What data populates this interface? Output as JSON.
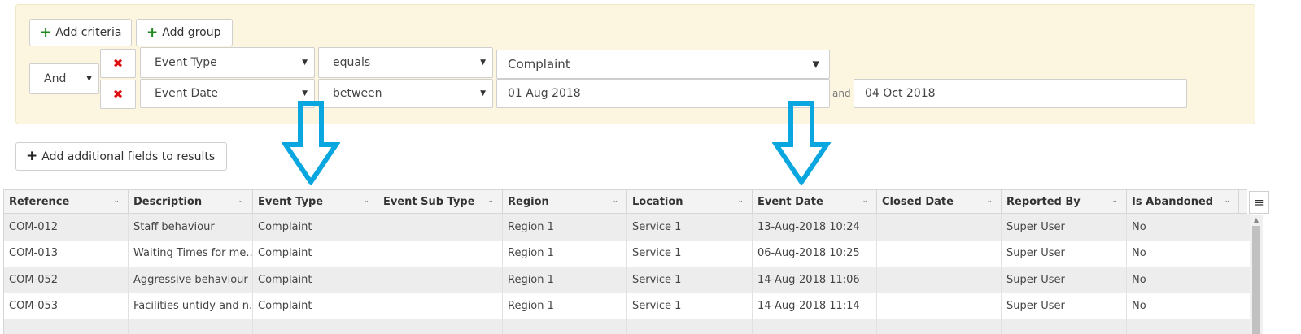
{
  "criteria": {
    "add_criteria_label": "Add criteria",
    "add_group_label": "Add group",
    "logic_operator": "And",
    "rows": [
      {
        "field": "Event Type",
        "operator": "equals",
        "value": "Complaint"
      },
      {
        "field": "Event Date",
        "operator": "between",
        "value_from": "01 Aug 2018",
        "joiner": "and",
        "value_to": "04 Oct 2018"
      }
    ]
  },
  "add_fields_label": "Add additional fields to results",
  "colors": {
    "accent_arrow": "#0aa6df",
    "panel_bg": "#fcf6e1",
    "remove_red": "#e01010",
    "add_green": "#1e8a1e"
  },
  "grid": {
    "columns": [
      "Reference",
      "Description",
      "Event Type",
      "Event Sub Type",
      "Region",
      "Location",
      "Event Date",
      "Closed Date",
      "Reported By",
      "Is Abandoned"
    ],
    "rows": [
      [
        "COM-012",
        "Staff behaviour",
        "Complaint",
        "",
        "Region 1",
        "Service 1",
        "13-Aug-2018 10:24",
        "",
        "Super User",
        "No"
      ],
      [
        "COM-013",
        "Waiting Times for me...",
        "Complaint",
        "",
        "Region 1",
        "Service 1",
        "06-Aug-2018 10:25",
        "",
        "Super User",
        "No"
      ],
      [
        "COM-052",
        "Aggressive behaviour",
        "Complaint",
        "",
        "Region 1",
        "Service 1",
        "14-Aug-2018 11:06",
        "",
        "Super User",
        "No"
      ],
      [
        "COM-053",
        "Facilities untidy and n...",
        "Complaint",
        "",
        "Region 1",
        "Service 1",
        "14-Aug-2018 11:14",
        "",
        "Super User",
        "No"
      ]
    ]
  }
}
